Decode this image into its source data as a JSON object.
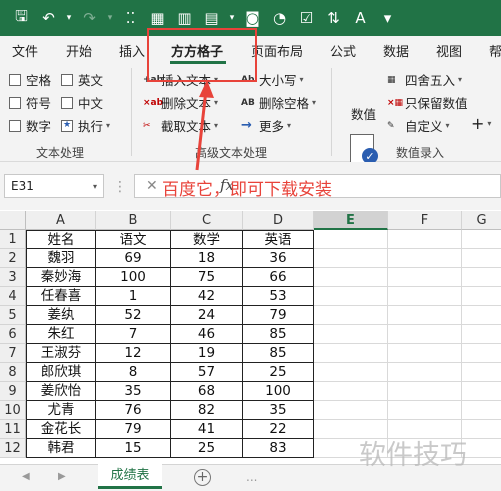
{
  "tabs": {
    "file": "文件",
    "home": "开始",
    "insert": "插入",
    "fangfang": "方方格子",
    "page_layout": "页面布局",
    "formula": "公式",
    "data": "数据",
    "view": "视图",
    "help": "帮"
  },
  "ribbon": {
    "text_group": {
      "label": "文本处理",
      "space": "空格",
      "english": "英文",
      "symbol": "符号",
      "chinese": "中文",
      "number": "数字",
      "execute": "执行"
    },
    "adv_group": {
      "label": "高级文本处理",
      "insert_text": "插入文本",
      "delete_text": "删除文本",
      "cut_text": "截取文本",
      "case": "大小写",
      "delete_space": "删除空格",
      "more": "更多"
    },
    "num_group": {
      "label": "数值录入",
      "value": "数值",
      "round": "四舍五入",
      "keep_value": "只保留数值",
      "custom": "自定义",
      "plus": "+"
    }
  },
  "formula_bar": {
    "name_box": "E31",
    "fx": "fx",
    "content": ""
  },
  "grid": {
    "columns": [
      "A",
      "B",
      "C",
      "D",
      "E",
      "F",
      "G"
    ],
    "row_numbers": [
      "1",
      "2",
      "3",
      "4",
      "5",
      "6",
      "7",
      "8",
      "9",
      "10",
      "11",
      "12"
    ],
    "rows": [
      [
        "姓名",
        "语文",
        "数学",
        "英语"
      ],
      [
        "魏羽",
        "69",
        "18",
        "36"
      ],
      [
        "秦妙海",
        "100",
        "75",
        "66"
      ],
      [
        "任春喜",
        "1",
        "42",
        "53"
      ],
      [
        "姜纨",
        "52",
        "24",
        "79"
      ],
      [
        "朱红",
        "7",
        "46",
        "85"
      ],
      [
        "王淑芬",
        "12",
        "19",
        "85"
      ],
      [
        "郎欣琪",
        "8",
        "57",
        "25"
      ],
      [
        "姜欣怡",
        "35",
        "68",
        "100"
      ],
      [
        "尤青",
        "76",
        "82",
        "35"
      ],
      [
        "金花长",
        "79",
        "41",
        "22"
      ],
      [
        "韩君",
        "15",
        "25",
        "83"
      ]
    ]
  },
  "sheet_tabs": {
    "active": "成绩表",
    "more": "..."
  },
  "annotation": {
    "text": "百度它，即可下载安装"
  },
  "watermark": "软件技巧",
  "colors": {
    "excel_green": "#217346",
    "annotation_red": "#e8433a"
  }
}
